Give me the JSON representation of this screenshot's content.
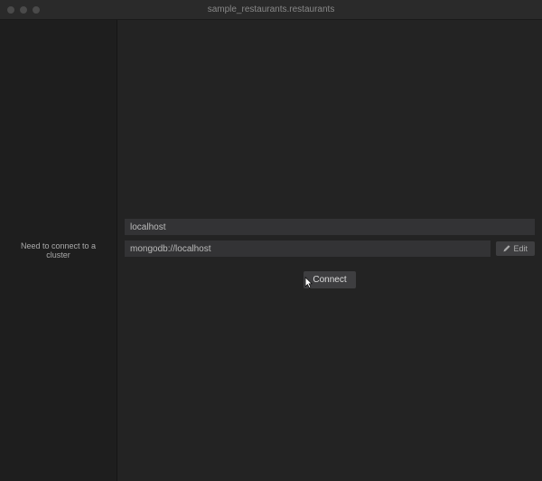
{
  "window": {
    "title": "sample_restaurants.restaurants"
  },
  "sidebar": {
    "message": "Need to connect to a cluster"
  },
  "form": {
    "name_value": "localhost",
    "uri_value": "mongodb://localhost",
    "edit_label": "Edit",
    "connect_label": "Connect"
  }
}
